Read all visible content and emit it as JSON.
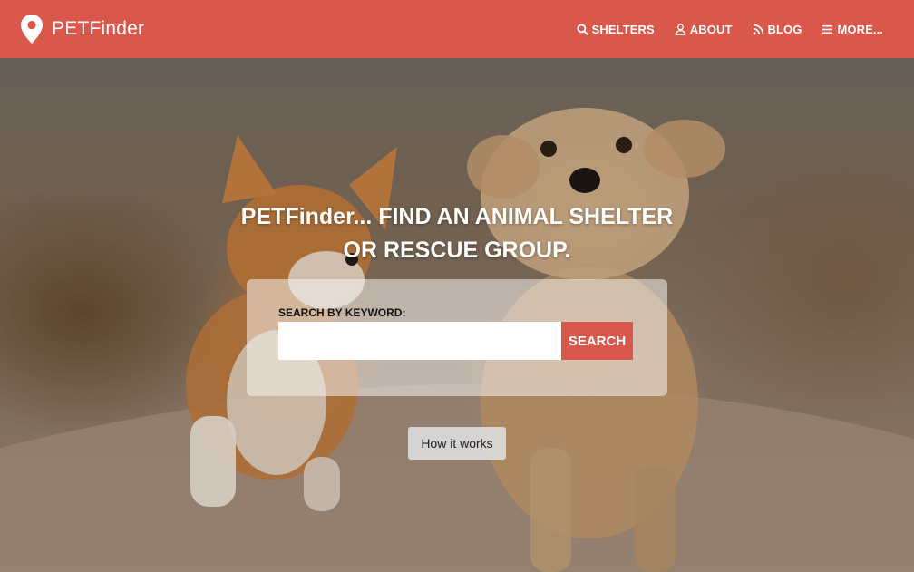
{
  "brand": {
    "name": "PETFinder",
    "icon": "map-pin-icon"
  },
  "nav": {
    "items": [
      {
        "label": "SHELTERS",
        "icon": "search-icon"
      },
      {
        "label": "ABOUT",
        "icon": "user-icon"
      },
      {
        "label": "BLOG",
        "icon": "rss-icon"
      },
      {
        "label": "MORE...",
        "icon": "menu-icon"
      }
    ]
  },
  "hero": {
    "title_line1": "PETFinder... FIND AN ANIMAL SHELTER",
    "title_line2": "OR RESCUE GROUP.",
    "background": "photo of two dogs running on a dirt path"
  },
  "search": {
    "label": "SEARCH BY KEYWORD:",
    "value": "",
    "placeholder": "",
    "button_label": "SEARCH"
  },
  "how_it_works": {
    "label": "How it works"
  },
  "colors": {
    "accent": "#d9574b",
    "nav_text": "#ffffff"
  }
}
